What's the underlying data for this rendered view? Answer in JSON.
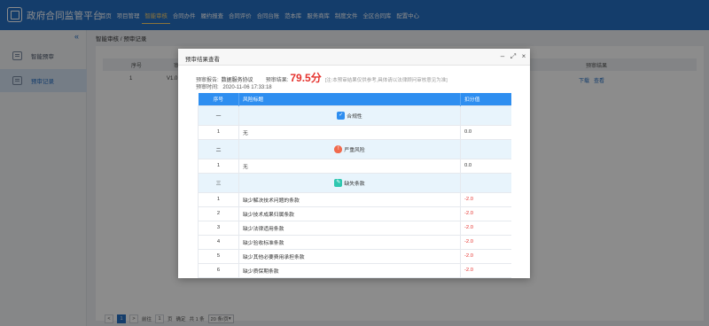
{
  "app": {
    "title": "政府合同监管平台",
    "nav": [
      "首页",
      "项目管理",
      "智能审核",
      "合同办件",
      "履约报查",
      "合同评价",
      "合同台账",
      "范本库",
      "服务商库",
      "制度文件",
      "全区合同库",
      "配置中心"
    ],
    "active_nav_index": 2
  },
  "sidebar": {
    "items": [
      {
        "label": "智能预审",
        "icon": "document-check-icon"
      },
      {
        "label": "预审记录",
        "icon": "list-record-icon"
      }
    ],
    "active_index": 1
  },
  "breadcrumb": "智能审核 / 预审记录",
  "background_table": {
    "headers": {
      "index": "序号",
      "version_col": "审核",
      "actions": "预审结果"
    },
    "row": {
      "index": "1",
      "version": "V1.0",
      "download": "下载",
      "view": "查看"
    }
  },
  "pagination": {
    "prev": "<",
    "current": "1",
    "next": ">",
    "goto_label": "前往",
    "page_input": "1",
    "page_unit": "页",
    "confirm": "确定",
    "total": "共 1 条",
    "page_size": "20 条/页"
  },
  "modal": {
    "title": "预审结果查看",
    "report_label": "预审报告:",
    "report_name": "数据服务协议",
    "score_label": "预审结果:",
    "score": "79.5分",
    "score_note": "[注:本预审结果仅供参考,具体请以法律顾问审核意见为准]",
    "time_label": "预审时间:",
    "time": "2020-11-06 17:33:18",
    "table_headers": {
      "index": "序号",
      "risk": "风险标题",
      "deduction": "扣分值"
    },
    "rows": [
      {
        "type": "group",
        "index": "一",
        "category": "合规性",
        "icon": "shield-check-icon",
        "icon_color": "#2e8ef0",
        "glyph": "✓"
      },
      {
        "type": "item",
        "index": "1",
        "title": "无",
        "score": "0.0"
      },
      {
        "type": "group",
        "index": "二",
        "category": "严重风险",
        "icon": "warning-icon",
        "icon_color": "#f06a4d",
        "glyph": "!"
      },
      {
        "type": "item",
        "index": "1",
        "title": "无",
        "score": "0.0"
      },
      {
        "type": "group",
        "index": "三",
        "category": "缺失条款",
        "icon": "missing-clause-icon",
        "icon_color": "#2ec7b0",
        "glyph": "✎"
      },
      {
        "type": "item",
        "index": "1",
        "title": "缺少解决技术问题的条款",
        "score": "-2.0"
      },
      {
        "type": "item",
        "index": "2",
        "title": "缺少技术成果归属条款",
        "score": "-2.0"
      },
      {
        "type": "item",
        "index": "3",
        "title": "缺少法律适用条款",
        "score": "-2.0"
      },
      {
        "type": "item",
        "index": "4",
        "title": "缺少验收标准条款",
        "score": "-2.0"
      },
      {
        "type": "item",
        "index": "5",
        "title": "缺少其他必要费用承担条款",
        "score": "-2.0"
      },
      {
        "type": "item",
        "index": "6",
        "title": "缺少质保期条款",
        "score": "-2.0"
      }
    ]
  }
}
